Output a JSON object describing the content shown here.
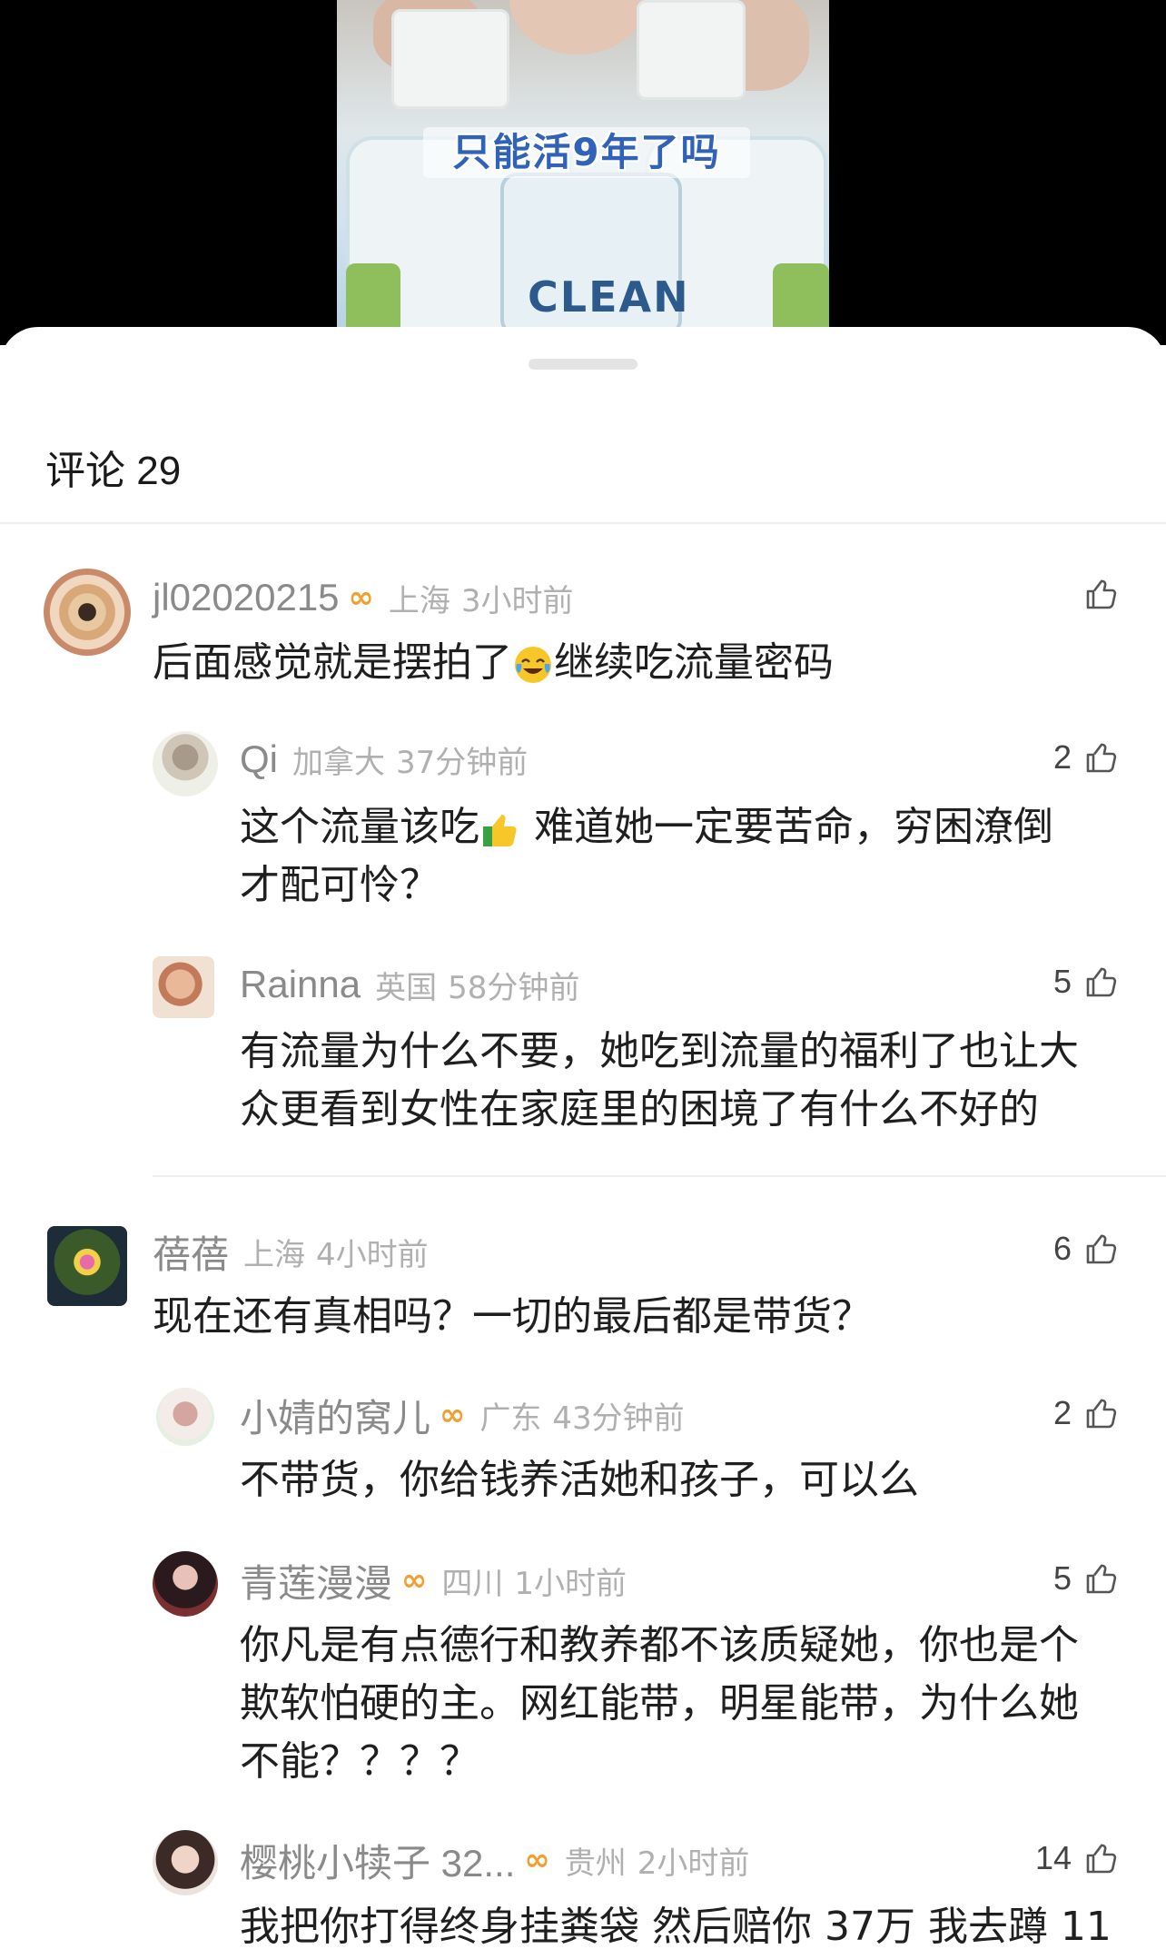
{
  "video": {
    "caption": "只能活9年了吗",
    "product_text": "CLEAN"
  },
  "sheet": {
    "title": "评论 29"
  },
  "comments": [
    {
      "username": "jl02020215",
      "vip": true,
      "location": "上海",
      "time": "3小时前",
      "likes": "",
      "text_a": "后面感觉就是摆拍了",
      "emoji": "crying-laughing-emoji",
      "text_b": "继续吃流量密码",
      "replies": [
        {
          "username": "Qi",
          "vip": false,
          "location": "加拿大",
          "time": "37分钟前",
          "likes": "2",
          "line1_a": "这个流量该吃",
          "emoji": "thumbs-up-emoji",
          "line1_b": " 难道她一定要苦命，穷困潦倒",
          "line2": "才配可怜？"
        },
        {
          "username": "Rainna",
          "vip": false,
          "location": "英国",
          "time": "58分钟前",
          "likes": "5",
          "line1": "有流量为什么不要，她吃到流量的福利了也让大",
          "line2": "众更看到女性在家庭里的困境了有什么不好的"
        }
      ]
    },
    {
      "username": "蓓蓓",
      "vip": false,
      "location": "上海",
      "time": "4小时前",
      "likes": "6",
      "text": "现在还有真相吗？一切的最后都是带货？",
      "replies": [
        {
          "username": "小婧的窝儿",
          "vip": true,
          "location": "广东",
          "time": "43分钟前",
          "likes": "2",
          "line1": "不带货，你给钱养活她和孩子，可以么"
        },
        {
          "username": "青莲漫漫",
          "vip": true,
          "location": "四川",
          "time": "1小时前",
          "likes": "5",
          "line1": "你凡是有点德行和教养都不该质疑她，你也是个",
          "line2": "欺软怕硬的主。网红能带，明星能带，为什么她",
          "line3": "不能？？？？"
        },
        {
          "username": "樱桃小犊子 32...",
          "vip": true,
          "location": "贵州",
          "time": "2小时前",
          "likes": "14",
          "line1": "我把你打得终身挂粪袋 然后赔你 37万 我去蹲 11"
        }
      ]
    }
  ],
  "colors": {
    "vip_badge": "#f0a030",
    "meta_gray": "#b0b0b0",
    "name_gray": "#8a8a8a",
    "text": "#1f1f1f"
  }
}
